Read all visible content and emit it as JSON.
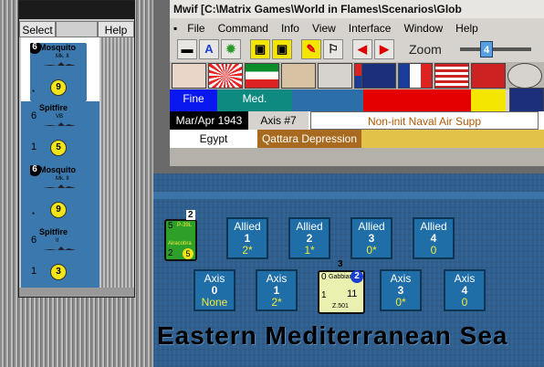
{
  "app_title": "Mwif [C:\\Matrix Games\\World in Flames\\Scenarios\\Glob",
  "menu": [
    "File",
    "Command",
    "Info",
    "View",
    "Interface",
    "Window",
    "Help"
  ],
  "palette": {
    "menu": [
      "Select",
      "Help"
    ],
    "counters": [
      {
        "name": "Mosquito",
        "sub": "Mk. II",
        "badge": "6",
        "value": "9",
        "left": "",
        "bg": "#3a78ad"
      },
      {
        "name": "Spitfire",
        "sub": "VB",
        "badge": "",
        "value": "5",
        "left": "6",
        "left2": "1",
        "bg": "#3a78ad"
      },
      {
        "name": "Mosquito",
        "sub": "Mk. II",
        "badge": "6",
        "value": "9",
        "left": "",
        "bg": "#3a78ad"
      },
      {
        "name": "Spitfire",
        "sub": "II",
        "badge": "",
        "value": "3",
        "left": "6",
        "left2": "1",
        "bg": "#3a78ad"
      }
    ]
  },
  "zoom": {
    "label": "Zoom",
    "value": "4"
  },
  "weather": [
    {
      "text": "Fine",
      "bg": "#0a18f0",
      "color": "#ffffff"
    },
    {
      "text": "Med.",
      "bg": "#0f8a80",
      "color": "#ffffff"
    },
    {
      "text": "",
      "bg": "#2c6fa8",
      "color": "#ffffff"
    },
    {
      "text": "",
      "bg": "#e50000",
      "color": "#ffffff"
    },
    {
      "text": "",
      "bg": "#f5e600",
      "color": "#000000"
    }
  ],
  "turn": {
    "date": "Mar/Apr 1943",
    "axis": "Axis #7",
    "phase": "Non-init Naval Air Supp"
  },
  "terrain": {
    "country": "Egypt",
    "region": "Qattara Depression"
  },
  "sea_name": "Eastern Mediterranean Sea",
  "allied_boxes": [
    {
      "title": "Allied",
      "num": "1",
      "val": "2*"
    },
    {
      "title": "Allied",
      "num": "2",
      "val": "1*"
    },
    {
      "title": "Allied",
      "num": "3",
      "val": "0*"
    },
    {
      "title": "Allied",
      "num": "4",
      "val": "0"
    }
  ],
  "axis_boxes": [
    {
      "title": "Axis",
      "num": "0",
      "val": "None"
    },
    {
      "title": "Axis",
      "num": "1",
      "val": "2*"
    },
    {
      "title": "Axis",
      "num": "3",
      "val": "0*"
    },
    {
      "title": "Axis",
      "num": "4",
      "val": "0"
    }
  ],
  "allied_unit": {
    "name": "P-39L",
    "sub": "Airacobra",
    "left_top": "5",
    "left_bot": "2",
    "value": "5",
    "stack": "2"
  },
  "axis_unit": {
    "name": "Gabbiano",
    "sub": "Z.501",
    "left": "0",
    "value": "11",
    "badge": "2",
    "stack": "3",
    "bot": "1"
  },
  "colors": {
    "accent": "#1f6ea8",
    "yellow": "#f0ea3a"
  }
}
